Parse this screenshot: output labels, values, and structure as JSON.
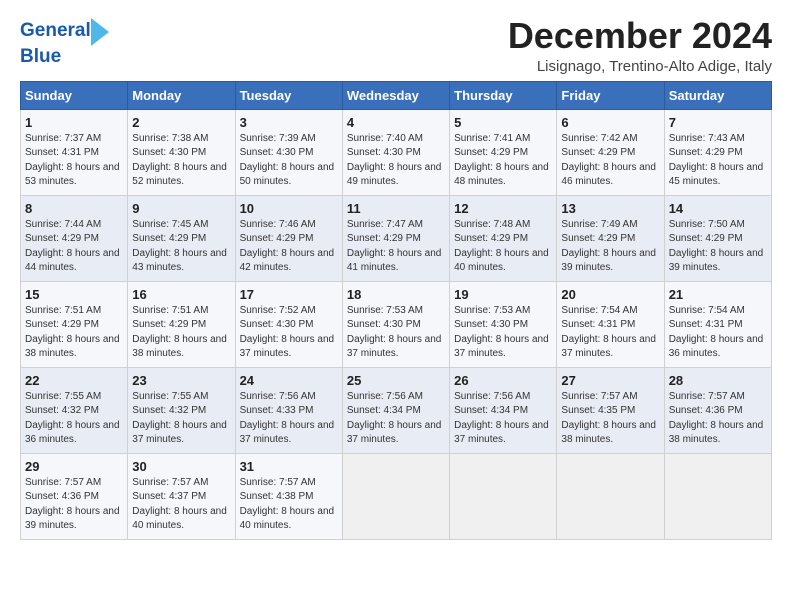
{
  "header": {
    "logo_line1": "General",
    "logo_line2": "Blue",
    "title": "December 2024",
    "location": "Lisignago, Trentino-Alto Adige, Italy"
  },
  "days_of_week": [
    "Sunday",
    "Monday",
    "Tuesday",
    "Wednesday",
    "Thursday",
    "Friday",
    "Saturday"
  ],
  "weeks": [
    [
      {
        "day": "1",
        "sunrise": "7:37 AM",
        "sunset": "4:31 PM",
        "daylight": "8 hours and 53 minutes."
      },
      {
        "day": "2",
        "sunrise": "7:38 AM",
        "sunset": "4:30 PM",
        "daylight": "8 hours and 52 minutes."
      },
      {
        "day": "3",
        "sunrise": "7:39 AM",
        "sunset": "4:30 PM",
        "daylight": "8 hours and 50 minutes."
      },
      {
        "day": "4",
        "sunrise": "7:40 AM",
        "sunset": "4:30 PM",
        "daylight": "8 hours and 49 minutes."
      },
      {
        "day": "5",
        "sunrise": "7:41 AM",
        "sunset": "4:29 PM",
        "daylight": "8 hours and 48 minutes."
      },
      {
        "day": "6",
        "sunrise": "7:42 AM",
        "sunset": "4:29 PM",
        "daylight": "8 hours and 46 minutes."
      },
      {
        "day": "7",
        "sunrise": "7:43 AM",
        "sunset": "4:29 PM",
        "daylight": "8 hours and 45 minutes."
      }
    ],
    [
      {
        "day": "8",
        "sunrise": "7:44 AM",
        "sunset": "4:29 PM",
        "daylight": "8 hours and 44 minutes."
      },
      {
        "day": "9",
        "sunrise": "7:45 AM",
        "sunset": "4:29 PM",
        "daylight": "8 hours and 43 minutes."
      },
      {
        "day": "10",
        "sunrise": "7:46 AM",
        "sunset": "4:29 PM",
        "daylight": "8 hours and 42 minutes."
      },
      {
        "day": "11",
        "sunrise": "7:47 AM",
        "sunset": "4:29 PM",
        "daylight": "8 hours and 41 minutes."
      },
      {
        "day": "12",
        "sunrise": "7:48 AM",
        "sunset": "4:29 PM",
        "daylight": "8 hours and 40 minutes."
      },
      {
        "day": "13",
        "sunrise": "7:49 AM",
        "sunset": "4:29 PM",
        "daylight": "8 hours and 39 minutes."
      },
      {
        "day": "14",
        "sunrise": "7:50 AM",
        "sunset": "4:29 PM",
        "daylight": "8 hours and 39 minutes."
      }
    ],
    [
      {
        "day": "15",
        "sunrise": "7:51 AM",
        "sunset": "4:29 PM",
        "daylight": "8 hours and 38 minutes."
      },
      {
        "day": "16",
        "sunrise": "7:51 AM",
        "sunset": "4:29 PM",
        "daylight": "8 hours and 38 minutes."
      },
      {
        "day": "17",
        "sunrise": "7:52 AM",
        "sunset": "4:30 PM",
        "daylight": "8 hours and 37 minutes."
      },
      {
        "day": "18",
        "sunrise": "7:53 AM",
        "sunset": "4:30 PM",
        "daylight": "8 hours and 37 minutes."
      },
      {
        "day": "19",
        "sunrise": "7:53 AM",
        "sunset": "4:30 PM",
        "daylight": "8 hours and 37 minutes."
      },
      {
        "day": "20",
        "sunrise": "7:54 AM",
        "sunset": "4:31 PM",
        "daylight": "8 hours and 37 minutes."
      },
      {
        "day": "21",
        "sunrise": "7:54 AM",
        "sunset": "4:31 PM",
        "daylight": "8 hours and 36 minutes."
      }
    ],
    [
      {
        "day": "22",
        "sunrise": "7:55 AM",
        "sunset": "4:32 PM",
        "daylight": "8 hours and 36 minutes."
      },
      {
        "day": "23",
        "sunrise": "7:55 AM",
        "sunset": "4:32 PM",
        "daylight": "8 hours and 37 minutes."
      },
      {
        "day": "24",
        "sunrise": "7:56 AM",
        "sunset": "4:33 PM",
        "daylight": "8 hours and 37 minutes."
      },
      {
        "day": "25",
        "sunrise": "7:56 AM",
        "sunset": "4:34 PM",
        "daylight": "8 hours and 37 minutes."
      },
      {
        "day": "26",
        "sunrise": "7:56 AM",
        "sunset": "4:34 PM",
        "daylight": "8 hours and 37 minutes."
      },
      {
        "day": "27",
        "sunrise": "7:57 AM",
        "sunset": "4:35 PM",
        "daylight": "8 hours and 38 minutes."
      },
      {
        "day": "28",
        "sunrise": "7:57 AM",
        "sunset": "4:36 PM",
        "daylight": "8 hours and 38 minutes."
      }
    ],
    [
      {
        "day": "29",
        "sunrise": "7:57 AM",
        "sunset": "4:36 PM",
        "daylight": "8 hours and 39 minutes."
      },
      {
        "day": "30",
        "sunrise": "7:57 AM",
        "sunset": "4:37 PM",
        "daylight": "8 hours and 40 minutes."
      },
      {
        "day": "31",
        "sunrise": "7:57 AM",
        "sunset": "4:38 PM",
        "daylight": "8 hours and 40 minutes."
      },
      null,
      null,
      null,
      null
    ]
  ]
}
